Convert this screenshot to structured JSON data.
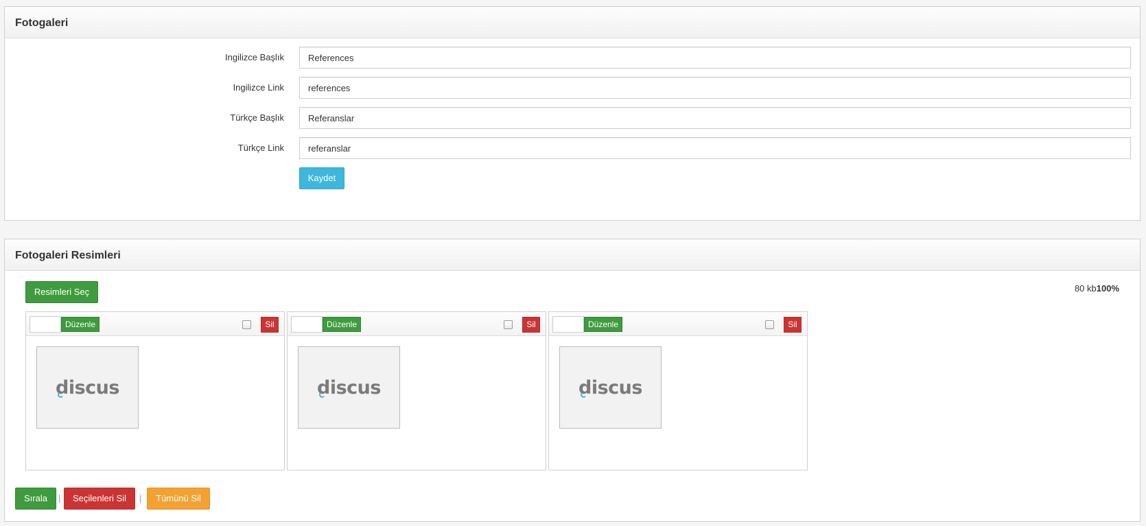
{
  "panel1": {
    "title": "Fotogaleri",
    "fields": [
      {
        "label": "Ingilizce Başlık",
        "value": "References"
      },
      {
        "label": "Ingilizce Link",
        "value": "references"
      },
      {
        "label": "Türkçe Başlık",
        "value": "Referanslar"
      },
      {
        "label": "Türkçe Link",
        "value": "referanslar"
      }
    ],
    "save_label": "Kaydet"
  },
  "panel2": {
    "title": "Fotogaleri Resimleri",
    "pick_label": "Resimleri Seç",
    "size_text": "80 kb",
    "percent_text": "100%",
    "cards": [
      {
        "order": "",
        "edit_label": "Düzenle",
        "delete_label": "Sil",
        "logo": "discus",
        "checked": false
      },
      {
        "order": "",
        "edit_label": "Düzenle",
        "delete_label": "Sil",
        "logo": "discus",
        "checked": false
      },
      {
        "order": "",
        "edit_label": "Düzenle",
        "delete_label": "Sil",
        "logo": "discus",
        "checked": false
      }
    ],
    "sort_label": "Sırala",
    "separator": "|",
    "delete_selected_label": "Seçilenleri Sil",
    "delete_all_label": "Tümünü Sil"
  },
  "colors": {
    "info": "#3fb7dc",
    "success": "#3e9b3e",
    "danger": "#cc3434",
    "warning": "#f3a231"
  }
}
